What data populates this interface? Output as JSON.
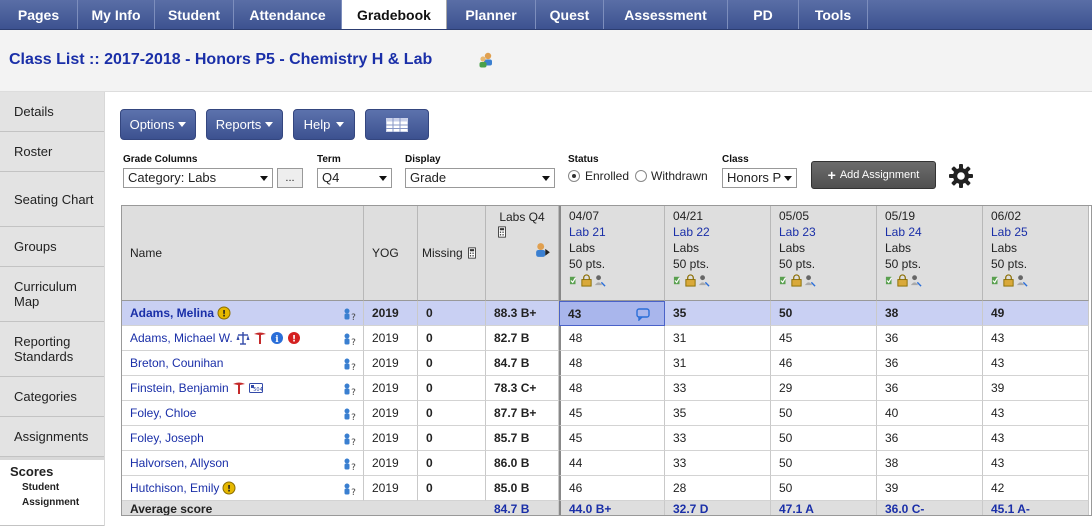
{
  "nav": {
    "tabs": [
      "Pages",
      "My Info",
      "Student",
      "Attendance",
      "Gradebook",
      "Planner",
      "Quest",
      "Assessment",
      "PD",
      "Tools"
    ],
    "active_index": 4
  },
  "title": "Class List :: 2017-2018 - Honors P5 - Chemistry H & Lab",
  "sidebar": {
    "items": [
      "Details",
      "Roster",
      "Seating Chart",
      "Groups",
      "Curriculum Map",
      "Reporting Standards",
      "Categories",
      "Assignments"
    ],
    "selected": {
      "label": "Scores",
      "sub": [
        "Student",
        "Assignment"
      ]
    }
  },
  "toolbar": {
    "options_label": "Options",
    "reports_label": "Reports",
    "help_label": "Help"
  },
  "filters": {
    "grade_columns_label": "Grade Columns",
    "grade_columns_value": "Category: Labs",
    "more_label": "...",
    "term_label": "Term",
    "term_value": "Q4",
    "display_label": "Display",
    "display_value": "Grade",
    "status_label": "Status",
    "status_enrolled": "Enrolled",
    "status_withdrawn": "Withdrawn",
    "class_label": "Class",
    "class_value": "Honors P",
    "add_assignment_label": "Add Assignment"
  },
  "grid": {
    "headers": {
      "name": "Name",
      "yog": "YOG",
      "missing": "Missing",
      "labs": "Labs Q4"
    },
    "assignments": [
      {
        "date": "04/07",
        "name": "Lab 21",
        "category": "Labs",
        "points": "50 pts."
      },
      {
        "date": "04/21",
        "name": "Lab 22",
        "category": "Labs",
        "points": "50 pts."
      },
      {
        "date": "05/05",
        "name": "Lab 23",
        "category": "Labs",
        "points": "50 pts."
      },
      {
        "date": "05/19",
        "name": "Lab 24",
        "category": "Labs",
        "points": "50 pts."
      },
      {
        "date": "06/02",
        "name": "Lab 25",
        "category": "Labs",
        "points": "50 pts."
      }
    ],
    "rows": [
      {
        "name": "Adams, Melina",
        "yog": "2019",
        "missing": "0",
        "avg": "88.3 B+",
        "scores": [
          "43",
          "35",
          "50",
          "38",
          "49"
        ]
      },
      {
        "name": "Adams, Michael W.",
        "yog": "2019",
        "missing": "0",
        "avg": "82.7 B",
        "scores": [
          "48",
          "31",
          "45",
          "36",
          "43"
        ]
      },
      {
        "name": "Breton, Counihan",
        "yog": "2019",
        "missing": "0",
        "avg": "84.7 B",
        "scores": [
          "48",
          "31",
          "46",
          "36",
          "43"
        ]
      },
      {
        "name": "Finstein, Benjamin",
        "yog": "2019",
        "missing": "0",
        "avg": "78.3 C+",
        "scores": [
          "48",
          "33",
          "29",
          "36",
          "39"
        ]
      },
      {
        "name": "Foley, Chloe",
        "yog": "2019",
        "missing": "0",
        "avg": "87.7 B+",
        "scores": [
          "45",
          "35",
          "50",
          "40",
          "43"
        ]
      },
      {
        "name": "Foley, Joseph",
        "yog": "2019",
        "missing": "0",
        "avg": "85.7 B",
        "scores": [
          "45",
          "33",
          "50",
          "36",
          "43"
        ]
      },
      {
        "name": "Halvorsen, Allyson",
        "yog": "2019",
        "missing": "0",
        "avg": "86.0 B",
        "scores": [
          "44",
          "33",
          "50",
          "38",
          "43"
        ]
      },
      {
        "name": "Hutchison, Emily",
        "yog": "2019",
        "missing": "0",
        "avg": "85.0 B",
        "scores": [
          "46",
          "28",
          "50",
          "39",
          "42"
        ]
      }
    ],
    "average": {
      "label": "Average score",
      "overall": "84.7 B",
      "scores": [
        "44.0 B+",
        "32.7 D",
        "47.1 A",
        "36.0 C-",
        "45.1 A-"
      ]
    }
  },
  "colors": {
    "nav_bg": "#3d5290",
    "link": "#1a2fa8",
    "selected_row": "#c9d0f3",
    "warning": "#e6b800",
    "alert": "#d42020"
  }
}
